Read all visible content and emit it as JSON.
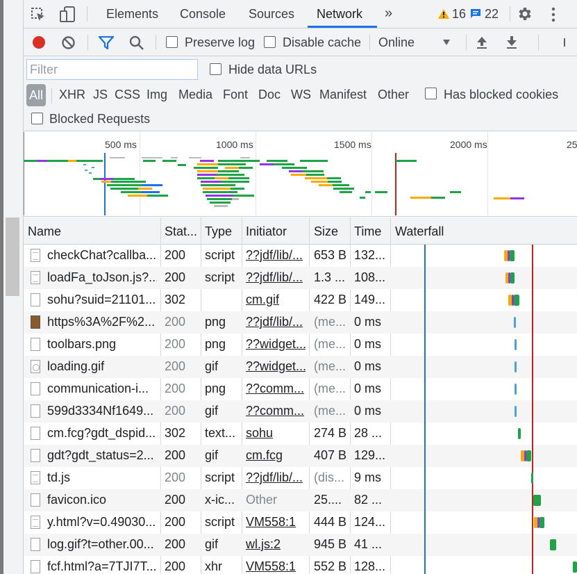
{
  "tabs": {
    "elements": "Elements",
    "console": "Console",
    "sources": "Sources",
    "network": "Network",
    "more": "»",
    "warnings": "16",
    "messages": "22"
  },
  "toolbar": {
    "preserve_log": "Preserve log",
    "disable_cache": "Disable cache",
    "throttle": "Online"
  },
  "filter": {
    "placeholder": "Filter",
    "hide_data_urls": "Hide data URLs",
    "types": [
      "All",
      "XHR",
      "JS",
      "CSS",
      "Img",
      "Media",
      "Font",
      "Doc",
      "WS",
      "Manifest",
      "Other"
    ],
    "has_blocked_cookies": "Has blocked cookies",
    "blocked_requests": "Blocked Requests"
  },
  "overview": {
    "ticks": [
      "500 ms",
      "1000 ms",
      "1500 ms",
      "2000 ms",
      "25"
    ]
  },
  "columns": {
    "name": "Name",
    "status": "Stat...",
    "type": "Type",
    "initiator": "Initiator",
    "size": "Size",
    "time": "Time",
    "waterfall": "Waterfall"
  },
  "rows": [
    {
      "name": "checkChat?callba...",
      "status": "200",
      "type": "script",
      "initiator": "??jdf/lib/...",
      "size": "653 B",
      "time": "132...",
      "icon": "script",
      "dim": false
    },
    {
      "name": "loadFa_toJson.js?...",
      "status": "200",
      "type": "script",
      "initiator": "??jdf/lib/...",
      "size": "1.3 ...",
      "time": "108...",
      "icon": "script",
      "dim": false
    },
    {
      "name": "sohu?suid=21101...",
      "status": "302",
      "type": "",
      "initiator": "cm.gif",
      "size": "422 B",
      "time": "149...",
      "icon": "blank",
      "dim": false
    },
    {
      "name": "https%3A%2F%2...",
      "status": "200",
      "type": "png",
      "initiator": "??jdf/lib/...",
      "size": "(me...",
      "time": "0 ms",
      "icon": "image",
      "dim": true
    },
    {
      "name": "toolbars.png",
      "status": "200",
      "type": "png",
      "initiator": "??widget...",
      "size": "(me...",
      "time": "0 ms",
      "icon": "blank",
      "dim": true
    },
    {
      "name": "loading.gif",
      "status": "200",
      "type": "gif",
      "initiator": "??widget...",
      "size": "(me...",
      "time": "0 ms",
      "icon": "gif",
      "dim": true
    },
    {
      "name": "communication-i...",
      "status": "200",
      "type": "png",
      "initiator": "??comm...",
      "size": "(me...",
      "time": "0 ms",
      "icon": "blank",
      "dim": true
    },
    {
      "name": "599d3334Nf1649...",
      "status": "200",
      "type": "gif",
      "initiator": "??comm...",
      "size": "(me...",
      "time": "0 ms",
      "icon": "blank",
      "dim": true
    },
    {
      "name": "cm.fcg?gdt_dspid...",
      "status": "302",
      "type": "text...",
      "initiator": "sohu",
      "size": "274 B",
      "time": "28 ...",
      "icon": "blank",
      "dim": false
    },
    {
      "name": "gdt?gdt_status=2...",
      "status": "200",
      "type": "gif",
      "initiator": "cm.fcg",
      "size": "407 B",
      "time": "129...",
      "icon": "blank",
      "dim": false
    },
    {
      "name": "td.js",
      "status": "200",
      "type": "script",
      "initiator": "??jdf/lib/...",
      "size": "(dis...",
      "time": "9 ms",
      "icon": "script",
      "dim": true
    },
    {
      "name": "favicon.ico",
      "status": "200",
      "type": "x-ic...",
      "initiator": "Other",
      "size": "25....",
      "time": "82 ...",
      "icon": "blank",
      "dim": false
    },
    {
      "name": "y.html?v=0.49030...",
      "status": "200",
      "type": "script",
      "initiator": "VM558:1",
      "size": "444 B",
      "time": "124...",
      "icon": "script",
      "dim": false
    },
    {
      "name": "log.gif?t=other.00...",
      "status": "200",
      "type": "gif",
      "initiator": "wl.js:2",
      "size": "945 B",
      "time": "41 ...",
      "icon": "blank",
      "dim": false
    },
    {
      "name": "fcf.html?a=7TJI7T...",
      "status": "200",
      "type": "xhr",
      "initiator": "VM558:1",
      "size": "552 B",
      "time": "128...",
      "icon": "blank",
      "dim": false
    }
  ]
}
